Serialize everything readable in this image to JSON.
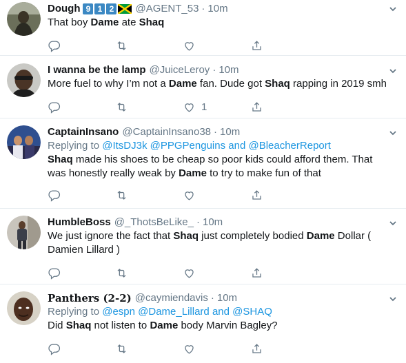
{
  "tweets": [
    {
      "name": "Dough",
      "badges": [
        "9",
        "1",
        "2"
      ],
      "handle": "@AGENT_53",
      "time": "10m",
      "text_parts": [
        "That boy ",
        "Dame",
        " ate ",
        "Shaq"
      ],
      "like_count": ""
    },
    {
      "name": "I wanna be the lamp",
      "handle": "@JuiceLeroy",
      "time": "10m",
      "text_parts": [
        "More fuel to why I’m not a ",
        "Dame",
        " fan. Dude got ",
        "Shaq",
        " rapping in 2019 smh"
      ],
      "like_count": "1"
    },
    {
      "name": "CaptainInsano",
      "handle": "@CaptainInsano38",
      "time": "10m",
      "reply_prefix": "Replying to ",
      "reply_links": [
        "@ItsDJ3k",
        "@PPGPenguins",
        "@BleacherReport"
      ],
      "reply_and": "and",
      "text_parts": [
        "Shaq",
        " made his shoes to be cheap so poor kids could afford them. That was honestly really weak by ",
        "Dame",
        " to try to make fun of that"
      ],
      "like_count": ""
    },
    {
      "name": "HumbleBoss",
      "handle": "@_ThotsBeLike_",
      "time": "10m",
      "text_parts": [
        "We just ignore the fact that ",
        "Shaq",
        " just completely bodied ",
        "Dame",
        " Dollar ( Damien Lillard )"
      ],
      "like_count": ""
    },
    {
      "name": "Panthers (2-2)",
      "handle": "@caymiendavis",
      "time": "10m",
      "reply_prefix": "Replying to ",
      "reply_links": [
        "@espn",
        "@Dame_Lillard",
        "@SHAQ"
      ],
      "reply_and": "and",
      "text_parts": [
        "Did ",
        "Shaq",
        " not listen to ",
        "Dame",
        " body Marvin Bagley?"
      ],
      "like_count": ""
    }
  ],
  "separator": "·",
  "colors": {
    "link": "#1b95e0",
    "muted": "#657786",
    "text": "#14171a",
    "badge": "#3b88c3"
  },
  "icons": [
    "reply-icon",
    "retweet-icon",
    "like-icon",
    "share-icon",
    "caret-down-icon",
    "jamaica-flag-icon"
  ]
}
